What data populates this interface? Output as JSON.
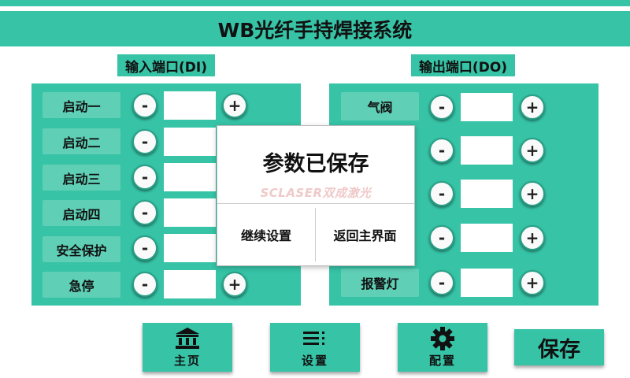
{
  "header": {
    "title": "WB光纤手持焊接系统"
  },
  "inputs": {
    "label": "输入端口(DI)",
    "rows": [
      {
        "name": "启动一",
        "has_plus": true
      },
      {
        "name": "启动二",
        "has_plus": false
      },
      {
        "name": "启动三",
        "has_plus": false
      },
      {
        "name": "启动四",
        "has_plus": false
      },
      {
        "name": "安全保护",
        "has_plus": false
      },
      {
        "name": "急停",
        "has_plus": true
      }
    ],
    "minus_symbol": "-",
    "plus_symbol": "+"
  },
  "outputs": {
    "label": "输出端口(DO)",
    "rows": [
      {
        "name": "气阀",
        "has_name": true
      },
      {
        "name": "",
        "has_name": false
      },
      {
        "name": "",
        "has_name": false
      },
      {
        "name": "",
        "has_name": false
      },
      {
        "name": "报警灯",
        "has_name": true
      }
    ],
    "minus_symbol": "-",
    "plus_symbol": "+"
  },
  "dialog": {
    "title": "参数已保存",
    "watermark": "SCLASER双成激光",
    "continue_label": "继续设置",
    "home_label": "返回主界面"
  },
  "nav": {
    "home_label": "主页",
    "home_icon": "bank-icon",
    "settings_label": "设置",
    "settings_icon": "menu-list-icon",
    "config_label": "配置",
    "config_icon": "gear-icon",
    "save_label": "保存"
  },
  "colors": {
    "accent": "#36c3a6",
    "name_box": "#5fcfb6"
  }
}
